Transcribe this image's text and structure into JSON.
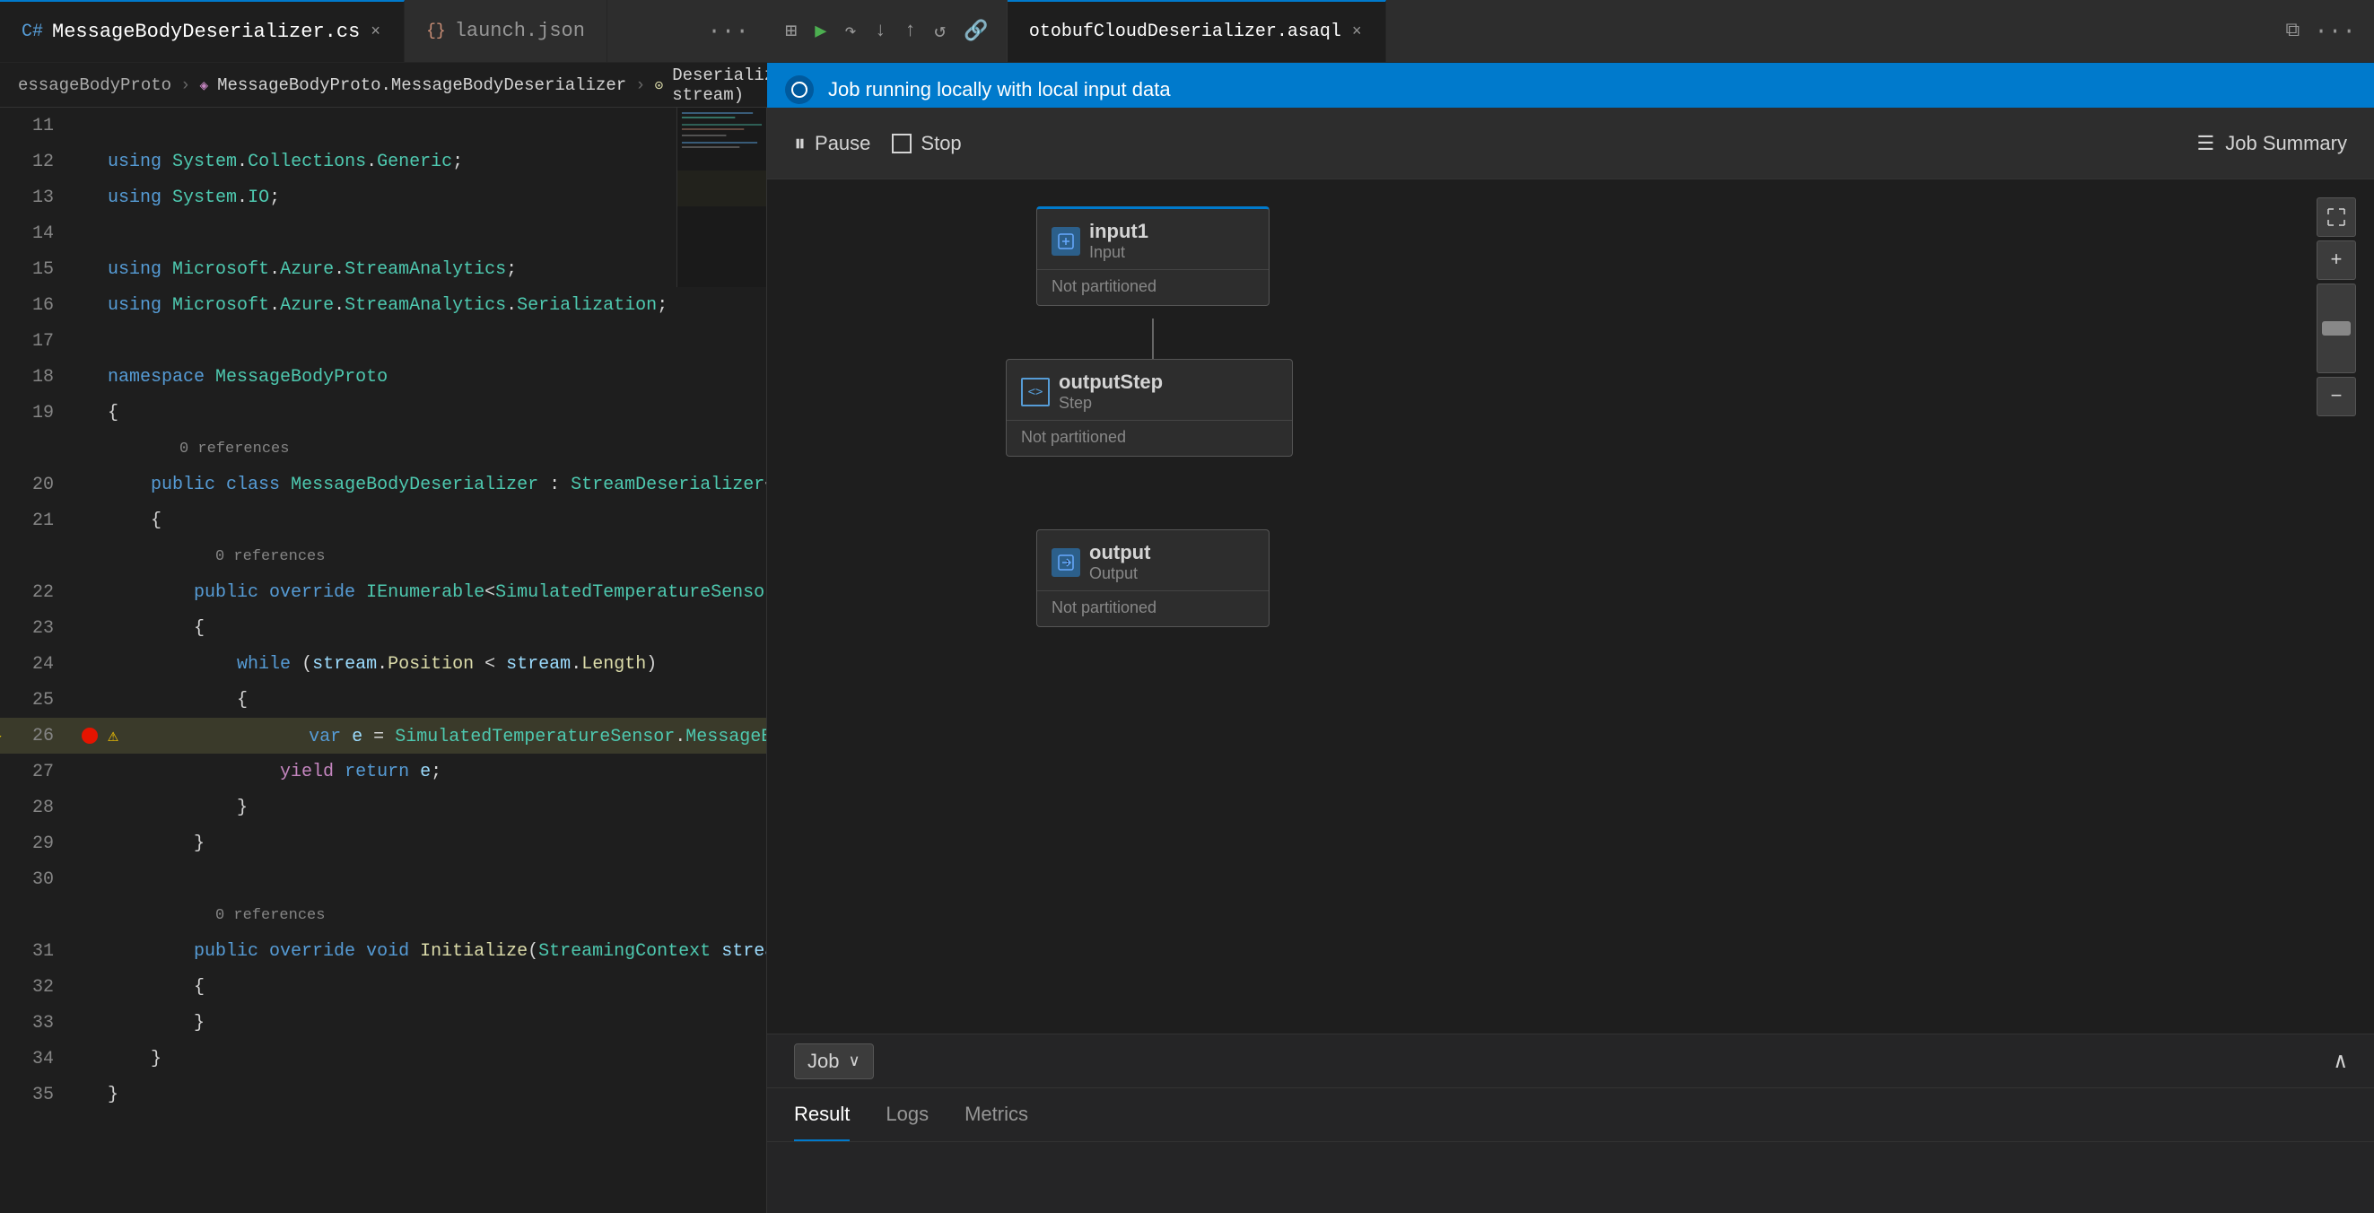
{
  "tabs": {
    "left": [
      {
        "id": "tab-cs",
        "label": "MessageBodyDeserializer.cs",
        "icon": "cs-icon",
        "active": true
      },
      {
        "id": "tab-json",
        "label": "launch.json",
        "icon": "json-icon",
        "active": false
      }
    ],
    "left_more": "...",
    "right": [
      {
        "id": "tab-asaql",
        "label": "otobufCloudDeserializer.asaql",
        "active": true
      }
    ],
    "right_more": "..."
  },
  "breadcrumb": {
    "items": [
      "essageBodyProto",
      "MessageBodyProto.MessageBodyDeserializer",
      "Deserialize(Stream stream)"
    ]
  },
  "code": {
    "lines": [
      {
        "num": 11,
        "content": "",
        "type": "blank"
      },
      {
        "num": 12,
        "content": "using System.Collections.Generic;",
        "type": "using"
      },
      {
        "num": 13,
        "content": "using System.IO;",
        "type": "using"
      },
      {
        "num": 14,
        "content": "",
        "type": "blank"
      },
      {
        "num": 15,
        "content": "using Microsoft.Azure.StreamAnalytics;",
        "type": "using"
      },
      {
        "num": 16,
        "content": "using Microsoft.Azure.StreamAnalytics.Serialization;",
        "type": "using"
      },
      {
        "num": 17,
        "content": "",
        "type": "blank"
      },
      {
        "num": 18,
        "content": "namespace MessageBodyProto",
        "type": "namespace"
      },
      {
        "num": 19,
        "content": "{",
        "type": "brace"
      },
      {
        "num": 20,
        "content": "public class MessageBodyDeserializer : StreamDeserializer<Simu",
        "type": "class",
        "refs": "0 references"
      },
      {
        "num": 21,
        "content": "{",
        "type": "brace"
      },
      {
        "num": 22,
        "content": "public override IEnumerable<SimulatedTemperatureSensor.Mes",
        "type": "method",
        "refs": "0 references"
      },
      {
        "num": 23,
        "content": "{",
        "type": "brace"
      },
      {
        "num": 24,
        "content": "while (stream.Position < stream.Length)",
        "type": "while"
      },
      {
        "num": 25,
        "content": "{",
        "type": "brace"
      },
      {
        "num": 26,
        "content": "var e = SimulatedTemperatureSensor.MessageBodyProt",
        "type": "var",
        "highlighted": true,
        "breakpoint": true,
        "debugArrow": true,
        "warning": true
      },
      {
        "num": 27,
        "content": "yield return e;",
        "type": "yield"
      },
      {
        "num": 28,
        "content": "}",
        "type": "brace"
      },
      {
        "num": 29,
        "content": "}",
        "type": "brace"
      },
      {
        "num": 30,
        "content": "",
        "type": "blank"
      },
      {
        "num": 31,
        "content": "public override void Initialize(StreamingContext streaming",
        "type": "method",
        "refs": "0 references"
      },
      {
        "num": 32,
        "content": "{",
        "type": "brace"
      },
      {
        "num": 33,
        "content": "}",
        "type": "brace"
      },
      {
        "num": 34,
        "content": "}",
        "type": "brace"
      },
      {
        "num": 35,
        "content": "}",
        "type": "brace"
      }
    ]
  },
  "right_panel": {
    "toolbar_icons": [
      "grid-icon",
      "play-icon",
      "step-over-icon",
      "step-into-icon",
      "step-out-icon",
      "restart-icon",
      "link-icon"
    ],
    "status_bar": {
      "text": "Job running locally with local input data",
      "icon": "running-icon"
    },
    "controls": {
      "pause_label": "Pause",
      "stop_label": "Stop",
      "job_summary_label": "Job Summary"
    },
    "diagram": {
      "nodes": [
        {
          "id": "input1",
          "label": "input1",
          "sublabel": "Input",
          "type": "input",
          "partition": "Not partitioned"
        },
        {
          "id": "outputStep",
          "label": "outputStep",
          "sublabel": "Step",
          "type": "step",
          "partition": "Not partitioned"
        },
        {
          "id": "output",
          "label": "output",
          "sublabel": "Output",
          "type": "output",
          "partition": "Not partitioned"
        }
      ]
    },
    "zoom_controls": {
      "fullscreen_label": "⛶",
      "plus_label": "+",
      "minus_label": "−"
    }
  },
  "bottom_panel": {
    "dropdown_label": "Job",
    "collapse_icon": "chevron-up-icon",
    "tabs": [
      {
        "id": "result",
        "label": "Result",
        "active": true
      },
      {
        "id": "logs",
        "label": "Logs",
        "active": false
      },
      {
        "id": "metrics",
        "label": "Metrics",
        "active": false
      }
    ]
  }
}
